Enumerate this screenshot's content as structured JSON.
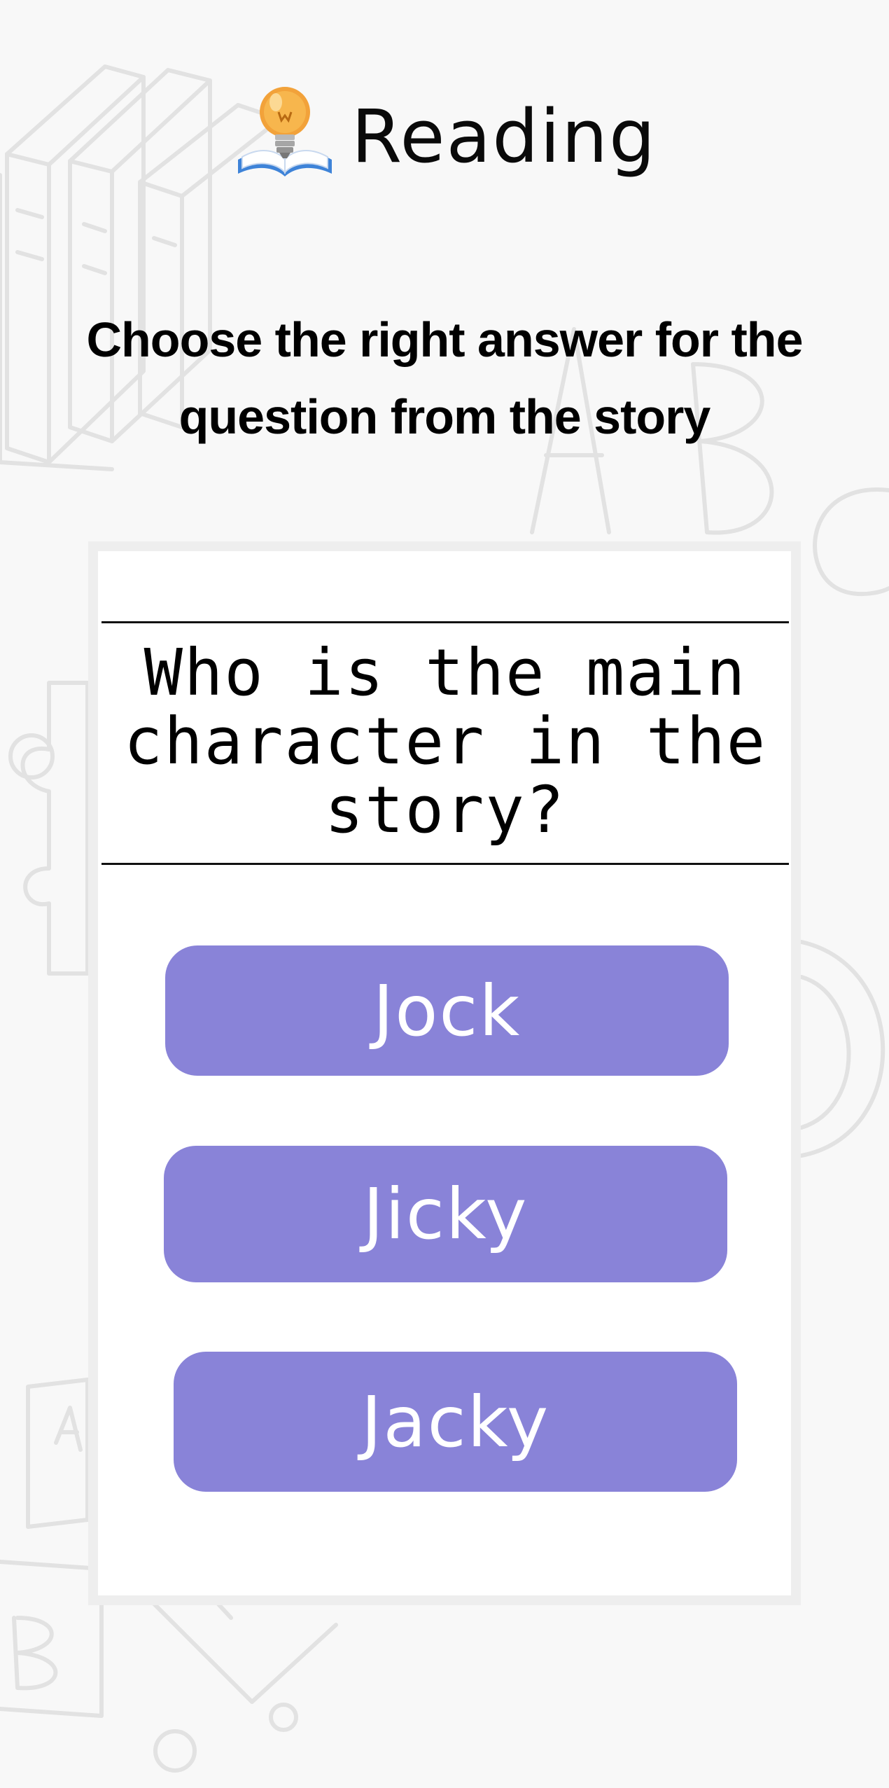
{
  "header": {
    "logo_icon": "lightbulb-book-icon",
    "title": "Reading"
  },
  "instruction": "Choose the right answer for the question from the story",
  "question": {
    "text": "Who is the main character in the story?"
  },
  "answers": [
    {
      "label": "Jock"
    },
    {
      "label": "Jicky"
    },
    {
      "label": "Jacky"
    }
  ],
  "colors": {
    "answer_button": "#8983d8",
    "answer_text": "#ffffff",
    "page_background": "#f8f8f8",
    "card_background": "#ffffff",
    "card_border": "#eeeeee",
    "decor_stroke": "#e2e2e2"
  }
}
